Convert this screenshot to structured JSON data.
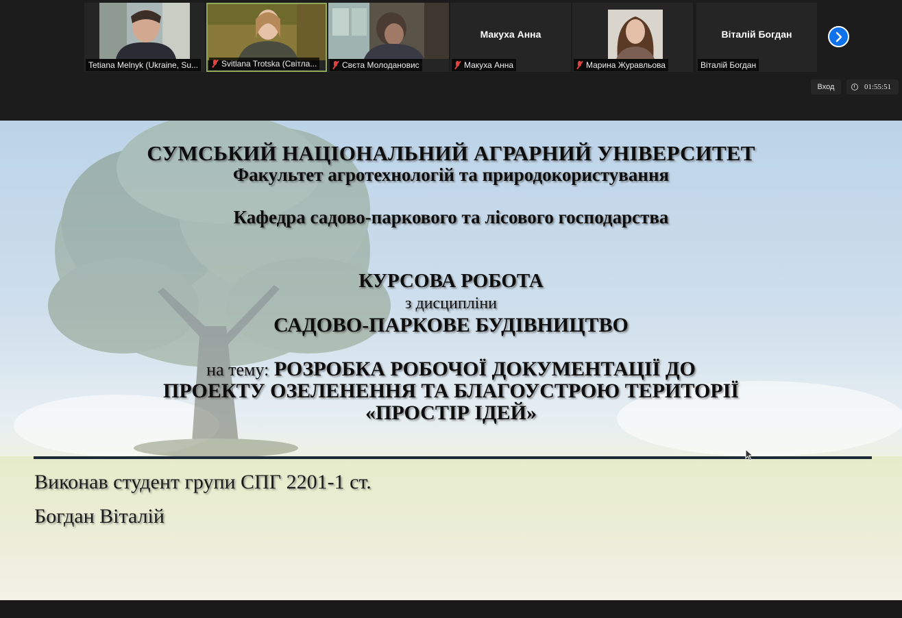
{
  "participants": [
    {
      "name": "Tetiana Melnyk (Ukraine, Su...",
      "muted": false,
      "video": true
    },
    {
      "name": "Svitlana Trotska (Світла...",
      "muted": true,
      "video": true,
      "active": true
    },
    {
      "name": "Свєта Молодановиc",
      "muted": true,
      "video": true
    },
    {
      "name": "Макуха Анна",
      "display_name": "Макуха Анна",
      "muted": true,
      "video": false
    },
    {
      "name": "Марина Журавльова",
      "muted": true,
      "video": true
    },
    {
      "name": "Віталій Богдан",
      "display_name": "Віталій Богдан",
      "muted": false,
      "video": false
    }
  ],
  "controls": {
    "vhod_label": "Вход",
    "timer": "01:55:51"
  },
  "slide": {
    "university": "СУМСЬКИЙ НАЦІОНАЛЬНИЙ АГРАРНИЙ УНІВЕРСИТЕТ",
    "faculty": "Факультет агротехнологій та природокористування",
    "department": "Кафедра садово-паркового та лісового господарства",
    "work_type": "КУРСОВА РОБОТА",
    "discipline_prefix": "з дисципліни",
    "discipline": "САДОВО-ПАРКОВЕ БУДІВНИЦТВО",
    "topic_prefix": "на тему:",
    "topic_line1": "РОЗРОБКА РОБОЧОЇ ДОКУМЕНТАЦІЇ ДО",
    "topic_line2": "ПРОЕКТУ ОЗЕЛЕНЕННЯ ТА БЛАГОУСТРОЮ ТЕРИТОРІЇ",
    "topic_line3": "«ПРОСТІР ІДЕЙ»",
    "author_line1": "Виконав студент групи СПГ 2201-1 ст.",
    "author_line2": "Богдан Віталій"
  },
  "colors": {
    "accent_blue": "#0e72ed",
    "muted_red": "#e0433f",
    "active_border": "#8fa85a"
  }
}
